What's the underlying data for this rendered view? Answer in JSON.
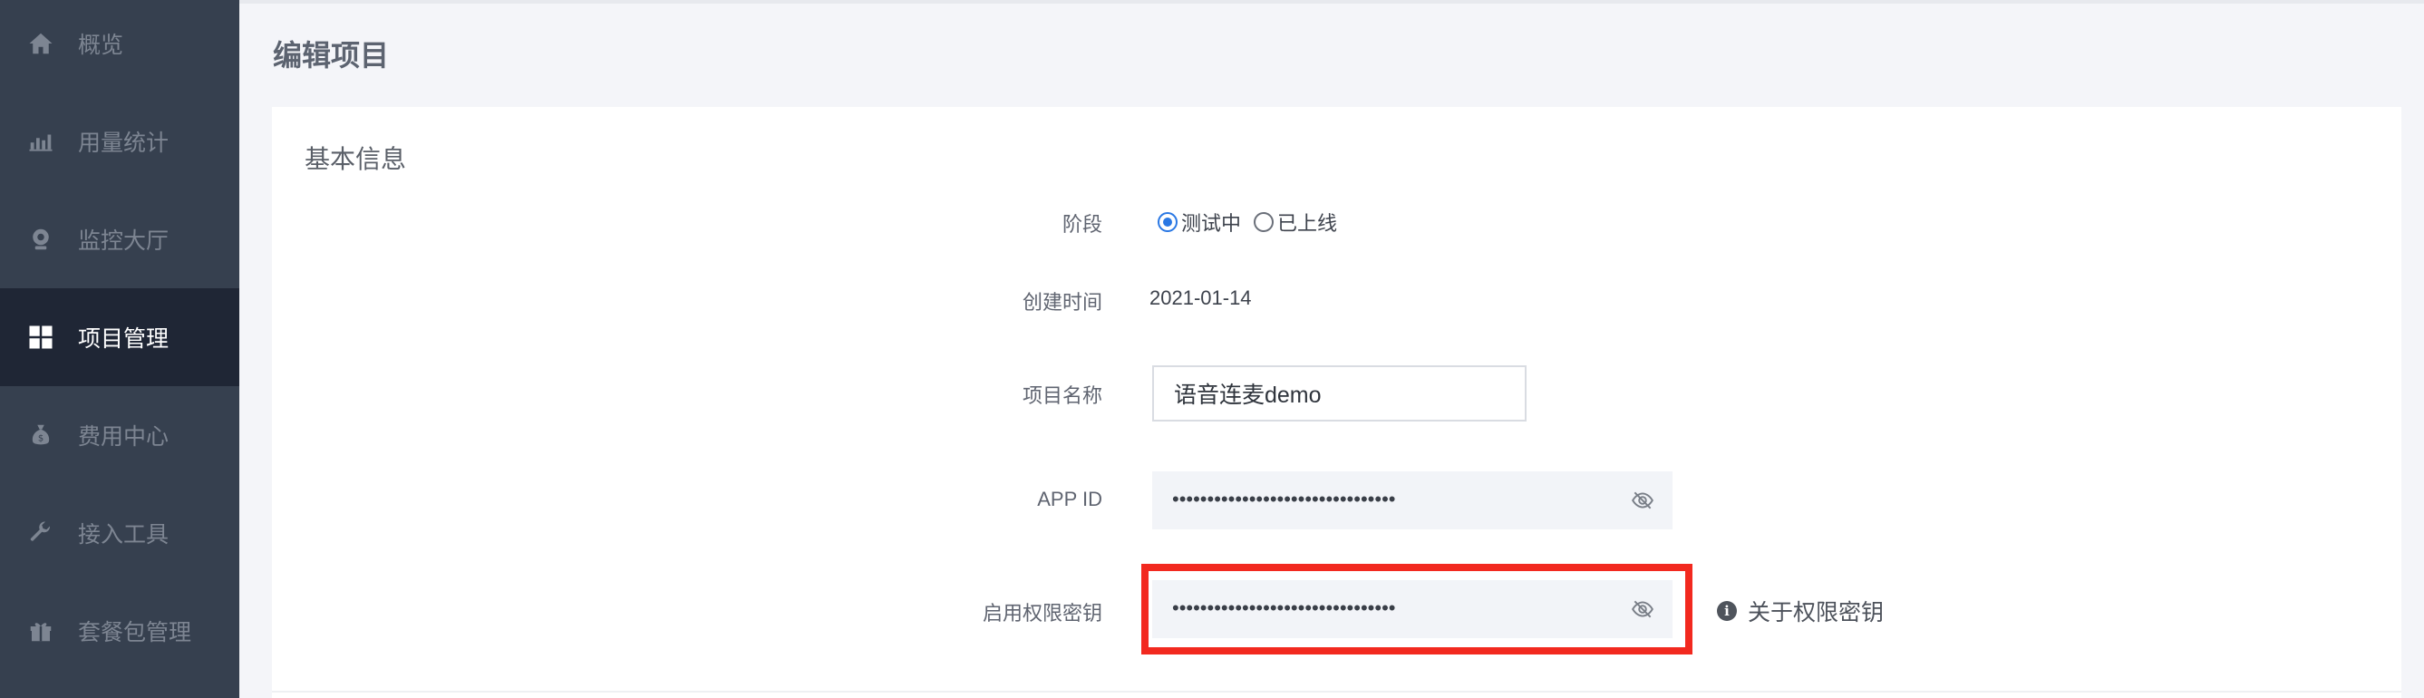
{
  "sidebar": {
    "items": [
      {
        "label": "概览",
        "icon": "home-icon",
        "active": false
      },
      {
        "label": "用量统计",
        "icon": "bar-chart-icon",
        "active": false
      },
      {
        "label": "监控大厅",
        "icon": "webcam-icon",
        "active": false
      },
      {
        "label": "项目管理",
        "icon": "grid-icon",
        "active": true
      },
      {
        "label": "费用中心",
        "icon": "money-bag-icon",
        "active": false
      },
      {
        "label": "接入工具",
        "icon": "wrench-icon",
        "active": false
      },
      {
        "label": "套餐包管理",
        "icon": "gift-icon",
        "active": false
      }
    ]
  },
  "page": {
    "title": "编辑项目",
    "section_title": "基本信息"
  },
  "form": {
    "stage": {
      "label": "阶段",
      "options": [
        {
          "label": "测试中",
          "checked": true
        },
        {
          "label": "已上线",
          "checked": false
        }
      ]
    },
    "created": {
      "label": "创建时间",
      "value": "2021-01-14"
    },
    "project_name": {
      "label": "项目名称",
      "value": "语音连麦demo"
    },
    "app_id": {
      "label": "APP ID",
      "masked_value": "••••••••••••••••••••••••••••••••",
      "icon": "eye-off-icon"
    },
    "secret_key": {
      "label": "启用权限密钥",
      "masked_value": "••••••••••••••••••••••••••••••••",
      "icon": "eye-off-icon",
      "help_link": "关于权限密钥",
      "help_icon": "info-icon"
    }
  },
  "colors": {
    "sidebar_bg": "#36404f",
    "sidebar_active_bg": "#1f2635",
    "radio_checked": "#2a78e4",
    "highlight_border": "#f2291f"
  }
}
